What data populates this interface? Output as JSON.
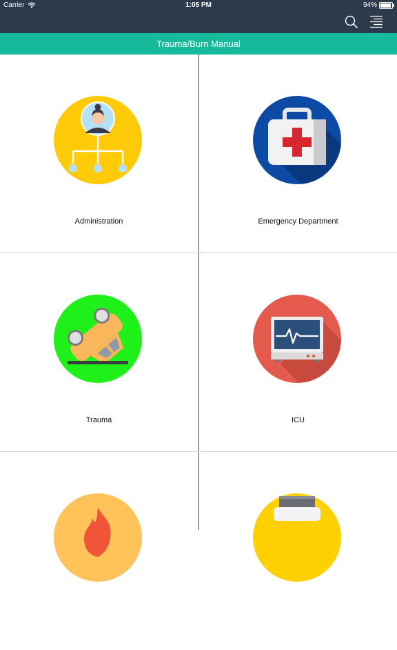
{
  "status_bar": {
    "carrier": "Carrier",
    "time": "1:05 PM",
    "battery": "94%"
  },
  "nav": {
    "search_icon": "search-icon",
    "menu_icon": "menu-icon"
  },
  "header": {
    "title": "Trauma/Burn Manual"
  },
  "tiles": [
    {
      "label": "Administration",
      "icon": "administration-icon",
      "color": "#ffca08"
    },
    {
      "label": "Emergency Department",
      "icon": "first-aid-kit-icon",
      "color": "#0c4aa6"
    },
    {
      "label": "Trauma",
      "icon": "overturned-car-icon",
      "color": "#1ff01a"
    },
    {
      "label": "ICU",
      "icon": "heart-monitor-icon",
      "color": "#e45a4c"
    },
    {
      "label": "",
      "icon": "burn-flame-icon",
      "color": "#ffc35a"
    },
    {
      "label": "",
      "icon": "medicine-bottle-icon",
      "color": "#ffd100"
    }
  ],
  "colors": {
    "nav_background": "#2c3a4b",
    "title_bar": "#17bb9b"
  }
}
